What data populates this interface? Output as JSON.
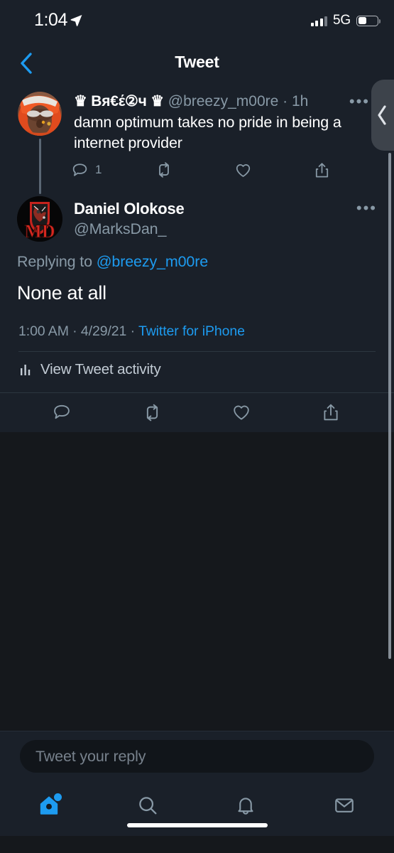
{
  "status_bar": {
    "time": "1:04",
    "location_icon": "location-arrow-icon",
    "signal_icon": "cellular-signal-icon",
    "network": "5G",
    "battery_icon": "battery-icon",
    "battery_level_pct": 40
  },
  "header": {
    "back_icon": "chevron-left-icon",
    "title": "Tweet"
  },
  "parent_tweet": {
    "avatar": "avatar-breezy",
    "display_name": "♛ Вя€έ②ч ♛",
    "handle": "@breezy_m00re",
    "time_ago": "· 1h",
    "text": "damn optimum takes no pride in being a internet provider",
    "more_icon": "more-options-icon",
    "actions": [
      {
        "name": "reply",
        "icon": "reply-icon",
        "count": "1"
      },
      {
        "name": "retweet",
        "icon": "retweet-icon",
        "count": ""
      },
      {
        "name": "like",
        "icon": "heart-icon",
        "count": ""
      },
      {
        "name": "share",
        "icon": "share-icon",
        "count": ""
      }
    ]
  },
  "main_tweet": {
    "avatar": "avatar-marksdan",
    "display_name": "Daniel Olokose",
    "handle": "@MarksDan_",
    "more_icon": "more-options-icon",
    "replying_to_label": "Replying to ",
    "replying_to_handle": "@breezy_m00re",
    "text": "None at all",
    "timestamp": "1:00 AM",
    "meta_separator_1": " · ",
    "date": "4/29/21",
    "meta_separator_2": " · ",
    "source": "Twitter for iPhone",
    "activity_icon": "bar-chart-icon",
    "activity_label": "View Tweet activity",
    "actions": [
      {
        "name": "reply",
        "icon": "reply-icon"
      },
      {
        "name": "retweet",
        "icon": "retweet-icon"
      },
      {
        "name": "like",
        "icon": "heart-icon"
      },
      {
        "name": "share",
        "icon": "share-icon"
      }
    ]
  },
  "back_gesture": {
    "icon": "chevron-left-icon"
  },
  "reply_bar": {
    "placeholder": "Tweet your reply"
  },
  "tab_bar": {
    "tabs": [
      {
        "name": "home",
        "icon": "home-icon",
        "active": true,
        "badge": true
      },
      {
        "name": "search",
        "icon": "search-icon",
        "active": false,
        "badge": false
      },
      {
        "name": "notifications",
        "icon": "bell-icon",
        "active": false,
        "badge": false
      },
      {
        "name": "messages",
        "icon": "envelope-icon",
        "active": false,
        "badge": false
      }
    ]
  },
  "colors": {
    "background": "#15181c",
    "surface": "#1a2029",
    "accent": "#1d9bf0",
    "text_primary": "#ffffff",
    "text_secondary": "#8899a6"
  }
}
